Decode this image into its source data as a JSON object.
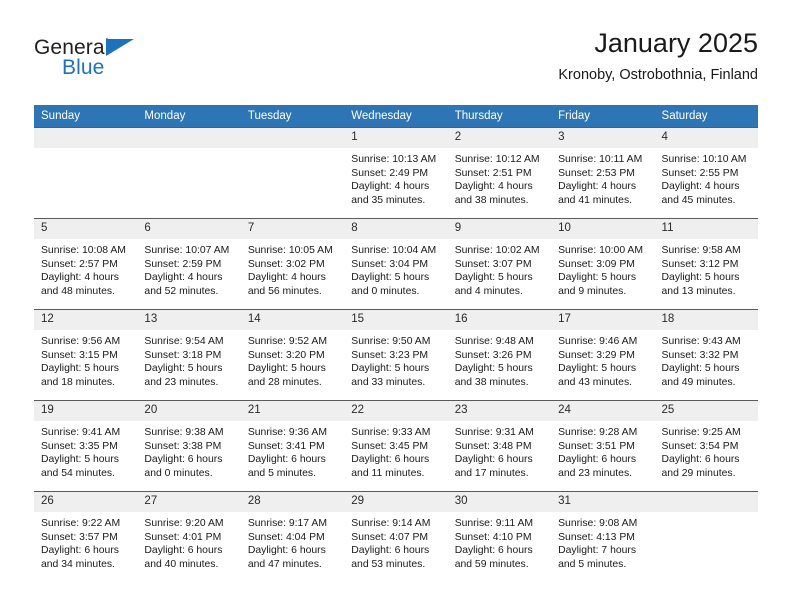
{
  "brand": {
    "name_part1": "General",
    "name_part2": "Blue",
    "triangle_color": "#1e72bb",
    "text_color": "#231f20"
  },
  "header": {
    "title": "January 2025",
    "subtitle": "Kronoby, Ostrobothnia, Finland"
  },
  "theme": {
    "header_blue": "#2e75b6",
    "daynum_band": "#efefef",
    "row_line": "#5a5a5a",
    "page_background": "#ffffff"
  },
  "weekdays": [
    "Sunday",
    "Monday",
    "Tuesday",
    "Wednesday",
    "Thursday",
    "Friday",
    "Saturday"
  ],
  "labels": {
    "sunrise_prefix": "Sunrise:",
    "sunset_prefix": "Sunset:",
    "daylight_prefix": "Daylight:"
  },
  "weeks": [
    [
      {
        "day": "",
        "blank": true
      },
      {
        "day": "",
        "blank": true
      },
      {
        "day": "",
        "blank": true
      },
      {
        "day": "1",
        "sunrise": "Sunrise: 10:13 AM",
        "sunset": "Sunset: 2:49 PM",
        "daylight_l1": "Daylight: 4 hours",
        "daylight_l2": "and 35 minutes."
      },
      {
        "day": "2",
        "sunrise": "Sunrise: 10:12 AM",
        "sunset": "Sunset: 2:51 PM",
        "daylight_l1": "Daylight: 4 hours",
        "daylight_l2": "and 38 minutes."
      },
      {
        "day": "3",
        "sunrise": "Sunrise: 10:11 AM",
        "sunset": "Sunset: 2:53 PM",
        "daylight_l1": "Daylight: 4 hours",
        "daylight_l2": "and 41 minutes."
      },
      {
        "day": "4",
        "sunrise": "Sunrise: 10:10 AM",
        "sunset": "Sunset: 2:55 PM",
        "daylight_l1": "Daylight: 4 hours",
        "daylight_l2": "and 45 minutes."
      }
    ],
    [
      {
        "day": "5",
        "sunrise": "Sunrise: 10:08 AM",
        "sunset": "Sunset: 2:57 PM",
        "daylight_l1": "Daylight: 4 hours",
        "daylight_l2": "and 48 minutes."
      },
      {
        "day": "6",
        "sunrise": "Sunrise: 10:07 AM",
        "sunset": "Sunset: 2:59 PM",
        "daylight_l1": "Daylight: 4 hours",
        "daylight_l2": "and 52 minutes."
      },
      {
        "day": "7",
        "sunrise": "Sunrise: 10:05 AM",
        "sunset": "Sunset: 3:02 PM",
        "daylight_l1": "Daylight: 4 hours",
        "daylight_l2": "and 56 minutes."
      },
      {
        "day": "8",
        "sunrise": "Sunrise: 10:04 AM",
        "sunset": "Sunset: 3:04 PM",
        "daylight_l1": "Daylight: 5 hours",
        "daylight_l2": "and 0 minutes."
      },
      {
        "day": "9",
        "sunrise": "Sunrise: 10:02 AM",
        "sunset": "Sunset: 3:07 PM",
        "daylight_l1": "Daylight: 5 hours",
        "daylight_l2": "and 4 minutes."
      },
      {
        "day": "10",
        "sunrise": "Sunrise: 10:00 AM",
        "sunset": "Sunset: 3:09 PM",
        "daylight_l1": "Daylight: 5 hours",
        "daylight_l2": "and 9 minutes."
      },
      {
        "day": "11",
        "sunrise": "Sunrise: 9:58 AM",
        "sunset": "Sunset: 3:12 PM",
        "daylight_l1": "Daylight: 5 hours",
        "daylight_l2": "and 13 minutes."
      }
    ],
    [
      {
        "day": "12",
        "sunrise": "Sunrise: 9:56 AM",
        "sunset": "Sunset: 3:15 PM",
        "daylight_l1": "Daylight: 5 hours",
        "daylight_l2": "and 18 minutes."
      },
      {
        "day": "13",
        "sunrise": "Sunrise: 9:54 AM",
        "sunset": "Sunset: 3:18 PM",
        "daylight_l1": "Daylight: 5 hours",
        "daylight_l2": "and 23 minutes."
      },
      {
        "day": "14",
        "sunrise": "Sunrise: 9:52 AM",
        "sunset": "Sunset: 3:20 PM",
        "daylight_l1": "Daylight: 5 hours",
        "daylight_l2": "and 28 minutes."
      },
      {
        "day": "15",
        "sunrise": "Sunrise: 9:50 AM",
        "sunset": "Sunset: 3:23 PM",
        "daylight_l1": "Daylight: 5 hours",
        "daylight_l2": "and 33 minutes."
      },
      {
        "day": "16",
        "sunrise": "Sunrise: 9:48 AM",
        "sunset": "Sunset: 3:26 PM",
        "daylight_l1": "Daylight: 5 hours",
        "daylight_l2": "and 38 minutes."
      },
      {
        "day": "17",
        "sunrise": "Sunrise: 9:46 AM",
        "sunset": "Sunset: 3:29 PM",
        "daylight_l1": "Daylight: 5 hours",
        "daylight_l2": "and 43 minutes."
      },
      {
        "day": "18",
        "sunrise": "Sunrise: 9:43 AM",
        "sunset": "Sunset: 3:32 PM",
        "daylight_l1": "Daylight: 5 hours",
        "daylight_l2": "and 49 minutes."
      }
    ],
    [
      {
        "day": "19",
        "sunrise": "Sunrise: 9:41 AM",
        "sunset": "Sunset: 3:35 PM",
        "daylight_l1": "Daylight: 5 hours",
        "daylight_l2": "and 54 minutes."
      },
      {
        "day": "20",
        "sunrise": "Sunrise: 9:38 AM",
        "sunset": "Sunset: 3:38 PM",
        "daylight_l1": "Daylight: 6 hours",
        "daylight_l2": "and 0 minutes."
      },
      {
        "day": "21",
        "sunrise": "Sunrise: 9:36 AM",
        "sunset": "Sunset: 3:41 PM",
        "daylight_l1": "Daylight: 6 hours",
        "daylight_l2": "and 5 minutes."
      },
      {
        "day": "22",
        "sunrise": "Sunrise: 9:33 AM",
        "sunset": "Sunset: 3:45 PM",
        "daylight_l1": "Daylight: 6 hours",
        "daylight_l2": "and 11 minutes."
      },
      {
        "day": "23",
        "sunrise": "Sunrise: 9:31 AM",
        "sunset": "Sunset: 3:48 PM",
        "daylight_l1": "Daylight: 6 hours",
        "daylight_l2": "and 17 minutes."
      },
      {
        "day": "24",
        "sunrise": "Sunrise: 9:28 AM",
        "sunset": "Sunset: 3:51 PM",
        "daylight_l1": "Daylight: 6 hours",
        "daylight_l2": "and 23 minutes."
      },
      {
        "day": "25",
        "sunrise": "Sunrise: 9:25 AM",
        "sunset": "Sunset: 3:54 PM",
        "daylight_l1": "Daylight: 6 hours",
        "daylight_l2": "and 29 minutes."
      }
    ],
    [
      {
        "day": "26",
        "sunrise": "Sunrise: 9:22 AM",
        "sunset": "Sunset: 3:57 PM",
        "daylight_l1": "Daylight: 6 hours",
        "daylight_l2": "and 34 minutes."
      },
      {
        "day": "27",
        "sunrise": "Sunrise: 9:20 AM",
        "sunset": "Sunset: 4:01 PM",
        "daylight_l1": "Daylight: 6 hours",
        "daylight_l2": "and 40 minutes."
      },
      {
        "day": "28",
        "sunrise": "Sunrise: 9:17 AM",
        "sunset": "Sunset: 4:04 PM",
        "daylight_l1": "Daylight: 6 hours",
        "daylight_l2": "and 47 minutes."
      },
      {
        "day": "29",
        "sunrise": "Sunrise: 9:14 AM",
        "sunset": "Sunset: 4:07 PM",
        "daylight_l1": "Daylight: 6 hours",
        "daylight_l2": "and 53 minutes."
      },
      {
        "day": "30",
        "sunrise": "Sunrise: 9:11 AM",
        "sunset": "Sunset: 4:10 PM",
        "daylight_l1": "Daylight: 6 hours",
        "daylight_l2": "and 59 minutes."
      },
      {
        "day": "31",
        "sunrise": "Sunrise: 9:08 AM",
        "sunset": "Sunset: 4:13 PM",
        "daylight_l1": "Daylight: 7 hours",
        "daylight_l2": "and 5 minutes."
      },
      {
        "day": "",
        "blank": true
      }
    ]
  ]
}
